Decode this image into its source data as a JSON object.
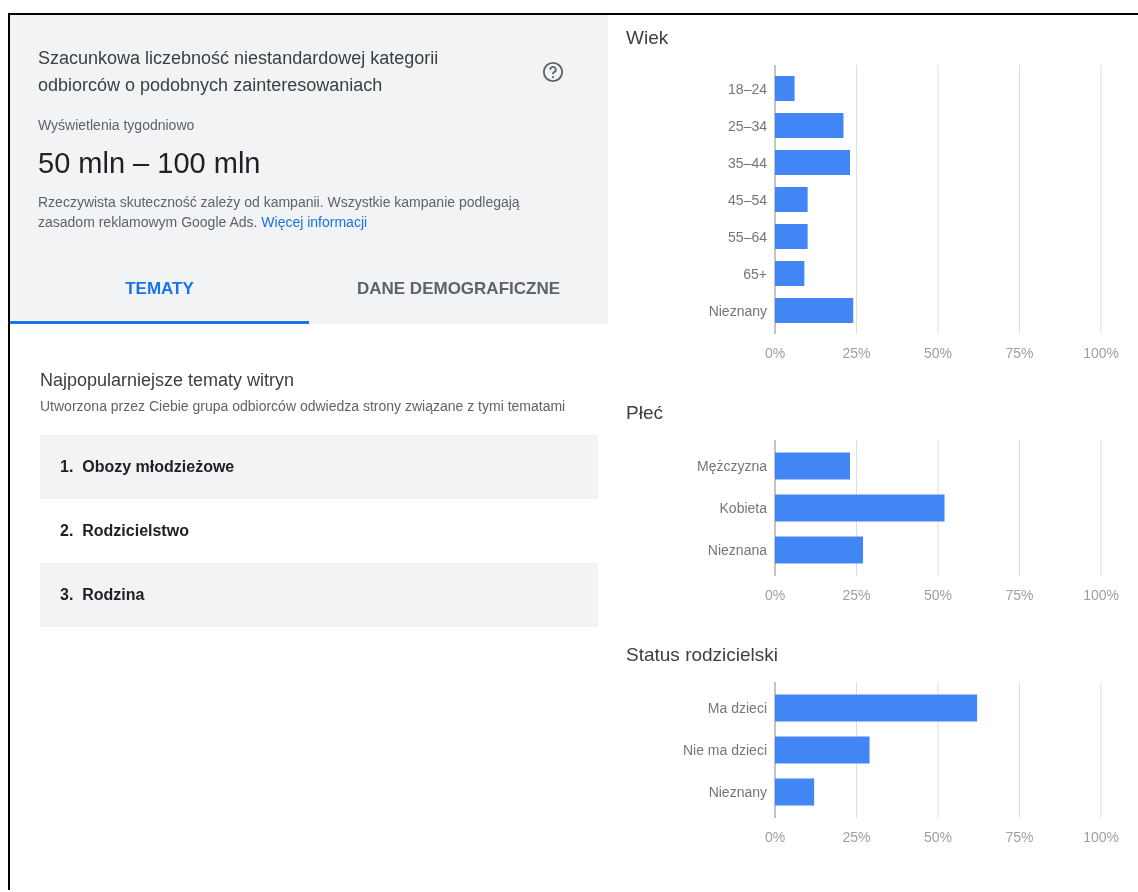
{
  "summary": {
    "title": "Szacunkowa liczebność niestandardowej kategorii odbiorców o podobnych zainteresowaniach",
    "metric_label": "Wyświetlenia tygodniowo",
    "metric_value": "50 mln – 100 mln",
    "note": "Rzeczywista skuteczność zależy od kampanii. Wszystkie kampanie podlegają zasadom reklamowym Google Ads.",
    "link": "Więcej informacji"
  },
  "tabs": [
    {
      "label": "TEMATY",
      "selected": true
    },
    {
      "label": "DANE DEMOGRAFICZNE",
      "selected": false
    }
  ],
  "topics": {
    "title": "Najpopularniejsze tematy witryn",
    "subtitle": "Utworzona przez Ciebie grupa odbiorców odwiedza strony związane z tymi tematami",
    "items": [
      {
        "number": "1.",
        "label": "Obozy młodzieżowe"
      },
      {
        "number": "2.",
        "label": "Rodzicielstwo"
      },
      {
        "number": "3.",
        "label": "Rodzina"
      }
    ]
  },
  "charts": [
    {
      "chart_data": {
        "type": "bar",
        "orientation": "horizontal",
        "grid": true,
        "title": "Wiek",
        "categories": [
          "18–24",
          "25–34",
          "35–44",
          "45–54",
          "55–64",
          "65+",
          "Nieznany"
        ],
        "values": [
          6,
          21,
          23,
          10,
          10,
          9,
          24
        ],
        "xlim": [
          0,
          100
        ],
        "xticks": [
          {
            "value": 0,
            "label": "0%"
          },
          {
            "value": 25,
            "label": "25%"
          },
          {
            "value": 50,
            "label": "50%"
          },
          {
            "value": 75,
            "label": "75%"
          },
          {
            "value": 100,
            "label": "100%"
          }
        ]
      }
    },
    {
      "chart_data": {
        "type": "bar",
        "orientation": "horizontal",
        "grid": true,
        "title": "Płeć",
        "categories": [
          "Mężczyzna",
          "Kobieta",
          "Nieznana"
        ],
        "values": [
          23,
          52,
          27
        ],
        "xlim": [
          0,
          100
        ],
        "xticks": [
          {
            "value": 0,
            "label": "0%"
          },
          {
            "value": 25,
            "label": "25%"
          },
          {
            "value": 50,
            "label": "50%"
          },
          {
            "value": 75,
            "label": "75%"
          },
          {
            "value": 100,
            "label": "100%"
          }
        ]
      }
    },
    {
      "chart_data": {
        "type": "bar",
        "orientation": "horizontal",
        "grid": true,
        "title": "Status rodzicielski",
        "categories": [
          "Ma dzieci",
          "Nie ma dzieci",
          "Nieznany"
        ],
        "values": [
          62,
          29,
          12
        ],
        "xlim": [
          0,
          100
        ],
        "xticks": [
          {
            "value": 0,
            "label": "0%"
          },
          {
            "value": 25,
            "label": "25%"
          },
          {
            "value": 50,
            "label": "50%"
          },
          {
            "value": 75,
            "label": "75%"
          },
          {
            "value": 100,
            "label": "100%"
          }
        ]
      }
    }
  ]
}
